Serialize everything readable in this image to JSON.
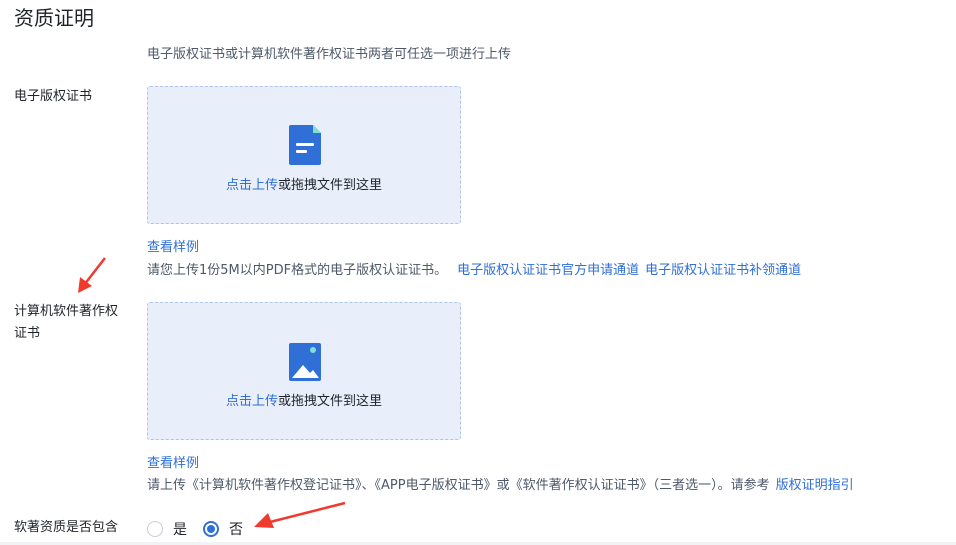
{
  "section": {
    "title": "资质证明",
    "hint": "电子版权证书或计算机软件著作权证书两者可任选一项进行上传"
  },
  "field1": {
    "label": "电子版权证书",
    "upload_link": "点击上传",
    "upload_rest": "或拖拽文件到这里",
    "sample": "查看样例",
    "desc": "请您上传1份5M以内PDF格式的电子版权认证证书。",
    "link1": "电子版权认证证书官方申请通道",
    "link2": "电子版权认证证书补领通道",
    "icon": "document-icon"
  },
  "field2": {
    "label_line1": "计算机软件著作权",
    "label_line2": "证书",
    "upload_link": "点击上传",
    "upload_rest": "或拖拽文件到这里",
    "sample": "查看样例",
    "desc": "请上传《计算机软件著作权登记证书》、《APP电子版权证书》或《软件著作权认证证书》（三者选一）。请参考",
    "link": "版权证明指引",
    "icon": "image-icon"
  },
  "field3": {
    "label": "软著资质是否包含",
    "option_yes": "是",
    "option_no": "否",
    "selected": "否"
  },
  "colors": {
    "accent": "#2f6fd6",
    "upload_bg": "#e8effb",
    "annotation_arrow": "#f03a2e"
  }
}
